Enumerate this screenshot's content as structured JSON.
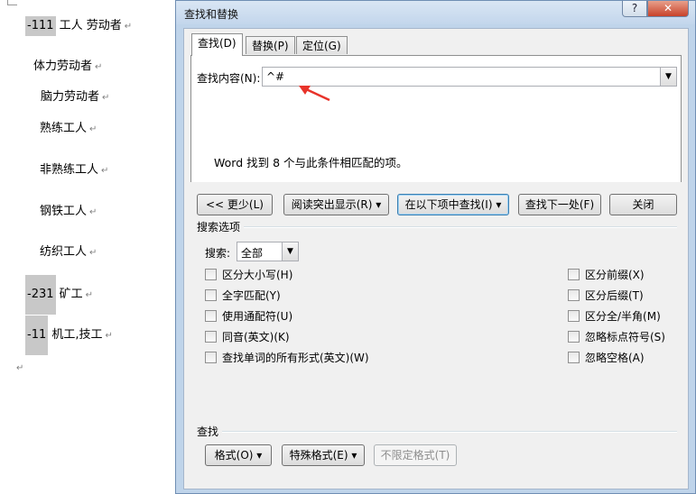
{
  "document": {
    "lines": [
      {
        "prefix": "-111",
        "text": " 工人   劳动者"
      },
      {
        "prefix": "",
        "text": "体力劳动者"
      },
      {
        "prefix": "",
        "text": "脑力劳动者"
      },
      {
        "prefix": "",
        "text": "熟练工人"
      },
      {
        "prefix": "",
        "text": "非熟练工人"
      },
      {
        "prefix": "",
        "text": "钢铁工人"
      },
      {
        "prefix": "",
        "text": "纺织工人"
      },
      {
        "prefix": "-231",
        "text": " 矿工"
      },
      {
        "prefix": "-11",
        "text": "  机工,技工"
      }
    ],
    "paragraph_mark": "↵"
  },
  "dialog": {
    "title": "查找和替换",
    "help_label": "?",
    "close_label": "✕",
    "tabs": [
      {
        "label": "查找(D)"
      },
      {
        "label": "替换(P)"
      },
      {
        "label": "定位(G)"
      }
    ],
    "find": {
      "label": "查找内容(N):",
      "value": "^#"
    },
    "status_text": "Word 找到 8 个与此条件相匹配的项。",
    "buttons": {
      "less": "<< 更少(L)",
      "reading_highlight": "阅读突出显示(R) ▾",
      "find_in": "在以下项中查找(I) ▾",
      "find_next": "查找下一处(F)",
      "close": "关闭"
    },
    "search_options": {
      "section_title": "搜索选项",
      "search_label": "搜索:",
      "search_value": "全部",
      "left_checkboxes": [
        {
          "label": "区分大小写(H)",
          "checked": false
        },
        {
          "label": "全字匹配(Y)",
          "checked": false
        },
        {
          "label": "使用通配符(U)",
          "checked": false
        },
        {
          "label": "同音(英文)(K)",
          "checked": false
        },
        {
          "label": "查找单词的所有形式(英文)(W)",
          "checked": false
        }
      ],
      "right_checkboxes": [
        {
          "label": "区分前缀(X)",
          "checked": false
        },
        {
          "label": "区分后缀(T)",
          "checked": false
        },
        {
          "label": "区分全/半角(M)",
          "checked": false
        },
        {
          "label": "忽略标点符号(S)",
          "checked": false
        },
        {
          "label": "忽略空格(A)",
          "checked": false
        }
      ]
    },
    "find_section": {
      "title": "查找",
      "format_button": "格式(O) ▾",
      "special_button": "特殊格式(E) ▾",
      "no_format_button": "不限定格式(T)"
    },
    "colors": {
      "arrow": "#e8332a",
      "dialog_frame": "#bfd4ea"
    }
  }
}
